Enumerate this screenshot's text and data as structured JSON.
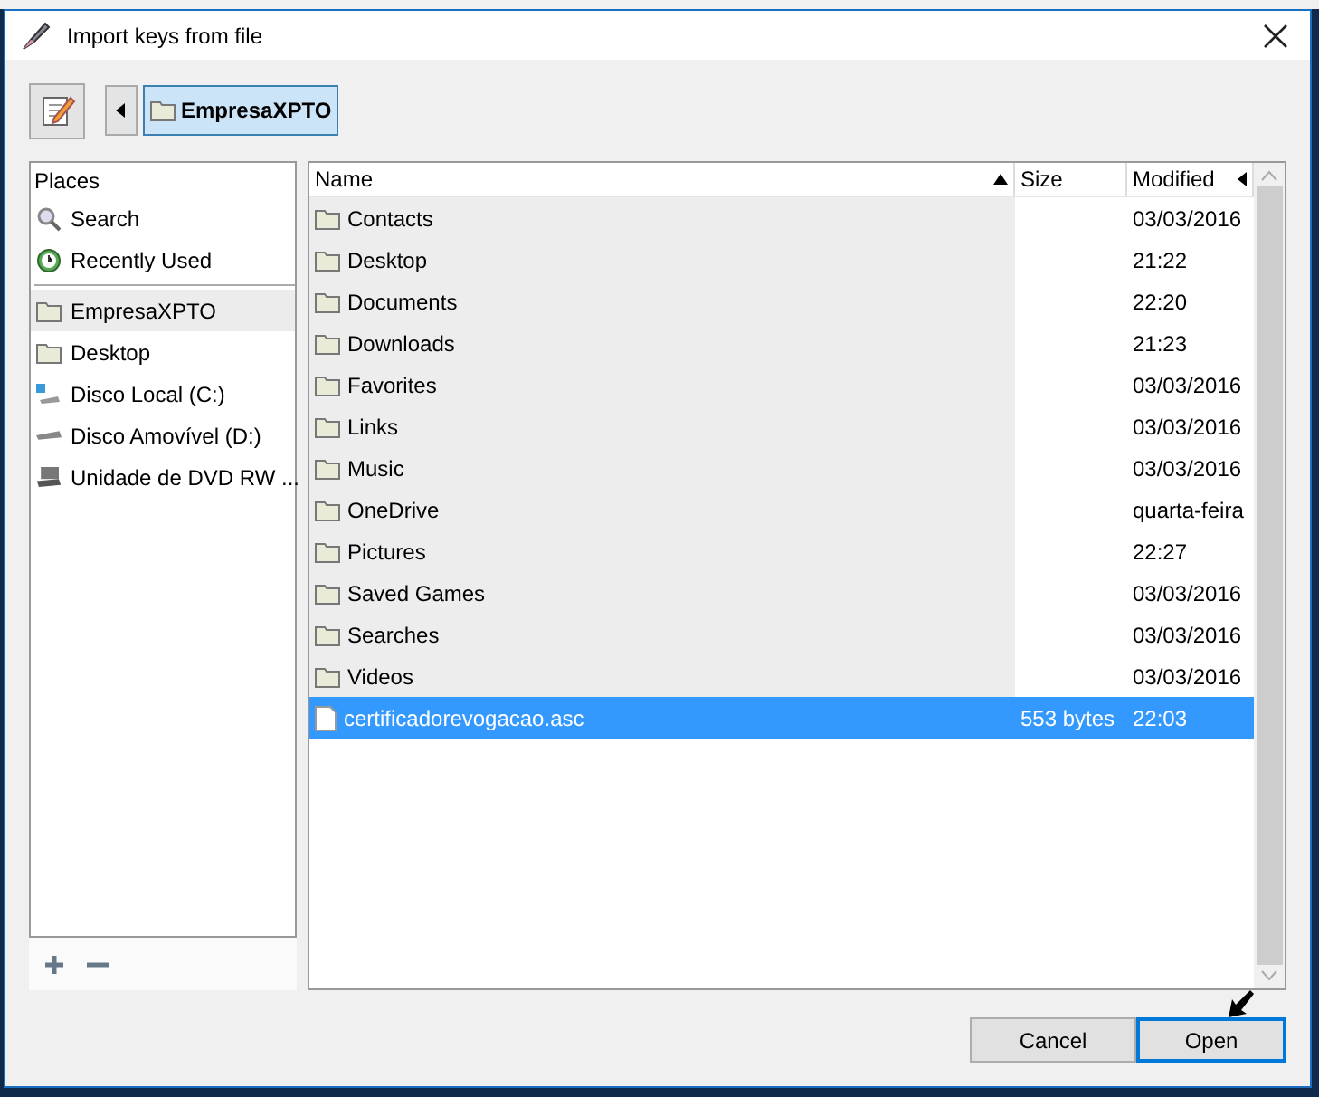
{
  "window": {
    "title": "Import keys from file"
  },
  "path_bar": {
    "folders": [
      {
        "label": "EmpresaXPTO",
        "selected": true
      }
    ]
  },
  "places": {
    "header": "Places",
    "items": [
      {
        "label": "Search",
        "kind": "search",
        "selected": false
      },
      {
        "label": "Recently Used",
        "kind": "recent",
        "selected": false
      },
      {
        "label": "EmpresaXPTO",
        "kind": "folder",
        "selected": true
      },
      {
        "label": "Desktop",
        "kind": "folder",
        "selected": false
      },
      {
        "label": "Disco Local (C:)",
        "kind": "drive",
        "selected": false
      },
      {
        "label": "Disco Amovível (D:)",
        "kind": "removable",
        "selected": false
      },
      {
        "label": "Unidade de DVD RW ...",
        "kind": "dvd",
        "selected": false
      }
    ]
  },
  "files": {
    "columns": [
      {
        "label": "Name",
        "sorted": true
      },
      {
        "label": "Size",
        "sorted": false
      },
      {
        "label": "Modified",
        "sorted": false
      }
    ],
    "rows": [
      {
        "kind": "folder",
        "name": "Contacts",
        "size": "",
        "modified": "03/03/2016",
        "selected": false
      },
      {
        "kind": "folder",
        "name": "Desktop",
        "size": "",
        "modified": "21:22",
        "selected": false
      },
      {
        "kind": "folder",
        "name": "Documents",
        "size": "",
        "modified": "22:20",
        "selected": false
      },
      {
        "kind": "folder",
        "name": "Downloads",
        "size": "",
        "modified": "21:23",
        "selected": false
      },
      {
        "kind": "folder",
        "name": "Favorites",
        "size": "",
        "modified": "03/03/2016",
        "selected": false
      },
      {
        "kind": "folder",
        "name": "Links",
        "size": "",
        "modified": "03/03/2016",
        "selected": false
      },
      {
        "kind": "folder",
        "name": "Music",
        "size": "",
        "modified": "03/03/2016",
        "selected": false
      },
      {
        "kind": "folder",
        "name": "OneDrive",
        "size": "",
        "modified": "quarta-feira",
        "selected": false
      },
      {
        "kind": "folder",
        "name": "Pictures",
        "size": "",
        "modified": "22:27",
        "selected": false
      },
      {
        "kind": "folder",
        "name": "Saved Games",
        "size": "",
        "modified": "03/03/2016",
        "selected": false
      },
      {
        "kind": "folder",
        "name": "Searches",
        "size": "",
        "modified": "03/03/2016",
        "selected": false
      },
      {
        "kind": "folder",
        "name": "Videos",
        "size": "",
        "modified": "03/03/2016",
        "selected": false
      },
      {
        "kind": "file",
        "name": "certificadorevogacao.asc",
        "size": "553 bytes",
        "modified": "22:03",
        "selected": true
      }
    ]
  },
  "buttons": [
    {
      "label": "Cancel",
      "selected": false
    },
    {
      "label": "Open",
      "selected": true
    }
  ]
}
